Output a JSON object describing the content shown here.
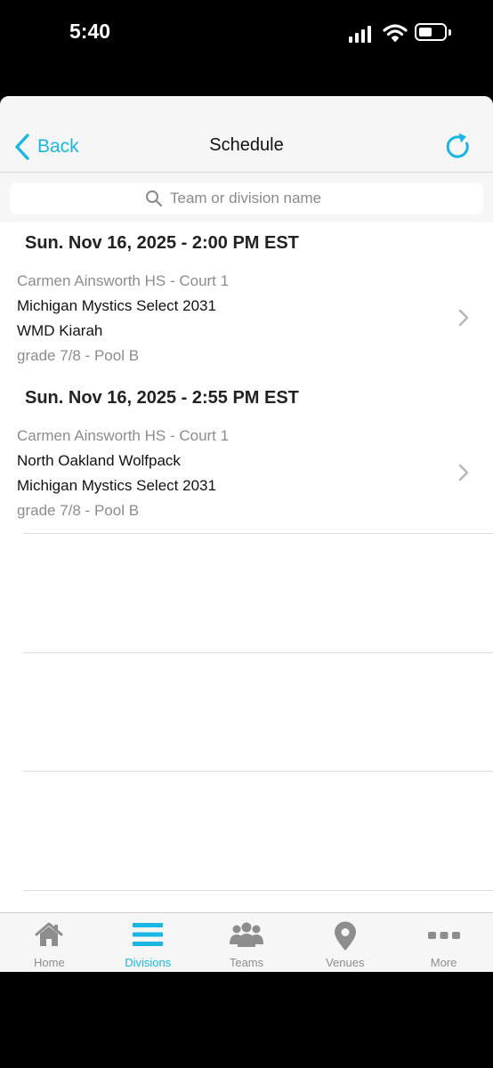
{
  "status_bar": {
    "time": "5:40"
  },
  "nav": {
    "back_label": "Back",
    "title": "Schedule"
  },
  "search": {
    "placeholder": "Team or division name"
  },
  "games": [
    {
      "datetime": "Sun. Nov 16, 2025 - 2:00 PM EST",
      "venue": "Carmen Ainsworth HS - Court 1",
      "team1": "Michigan Mystics Select 2031",
      "team2": "WMD Kiarah",
      "division": "grade 7/8 - Pool B"
    },
    {
      "datetime": "Sun. Nov 16, 2025 - 2:55 PM EST",
      "venue": "Carmen Ainsworth HS - Court 1",
      "team1": "North Oakland Wolfpack",
      "team2": "Michigan Mystics Select 2031",
      "division": "grade 7/8 - Pool B"
    }
  ],
  "tabs": [
    {
      "label": "Home",
      "icon": "home-icon",
      "active": false
    },
    {
      "label": "Divisions",
      "icon": "menu-lines-icon",
      "active": true
    },
    {
      "label": "Teams",
      "icon": "people-icon",
      "active": false
    },
    {
      "label": "Venues",
      "icon": "location-pin-icon",
      "active": false
    },
    {
      "label": "More",
      "icon": "more-dots-icon",
      "active": false
    }
  ],
  "colors": {
    "accent": "#1ab6e3",
    "inactive": "#8d8d8d"
  }
}
